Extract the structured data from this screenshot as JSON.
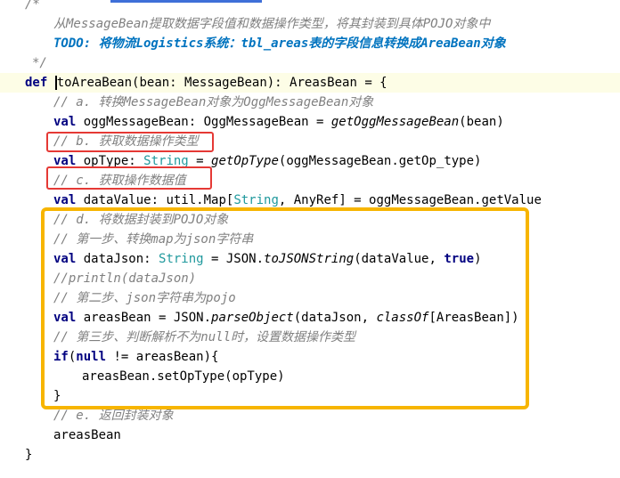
{
  "editor": {
    "lines": {
      "l0": "/*",
      "l1": "从MessageBean提取数据字段值和数据操作类型，将其封装到具体POJO对象中",
      "l2": "TODO: 将物流Logistics系统：tbl_areas表的字段信息转换成AreaBean对象",
      "l3": "*/",
      "l4_kw": "def",
      "l4_fn": "toAreaBean",
      "l4_rest": "(bean: MessageBean): AreasBean = {",
      "l5": "// a. 转换MessageBean对象为OggMessageBean对象",
      "l6_kw": "val",
      "l6_a": " oggMessageBean: OggMessageBean = ",
      "l6_fn": "getOggMessageBean",
      "l6_b": "(bean)",
      "l7": "// b. 获取数据操作类型",
      "l8_kw": "val",
      "l8_a": " opType: ",
      "l8_type": "String",
      "l8_b": " = ",
      "l8_fn": "getOpType",
      "l8_c": "(oggMessageBean.getOp_type)",
      "l9": "// c. 获取操作数据值",
      "l10_kw": "val",
      "l10_a": " dataValue: util.Map[",
      "l10_type": "String",
      "l10_b": ", AnyRef] = oggMessageBean.getValue",
      "l11": "// d. 将数据封装到POJO对象",
      "l12": "// 第一步、转换map为json字符串",
      "l13_kw": "val",
      "l13_a": " dataJson: ",
      "l13_type": "String",
      "l13_b": " = JSON.",
      "l13_fn": "toJSONString",
      "l13_c": "(dataValue, ",
      "l13_kw2": "true",
      "l13_d": ")",
      "l14": "//println(dataJson)",
      "l15": "// 第二步、json字符串为pojo",
      "l16_kw": "val",
      "l16_a": " areasBean = JSON.",
      "l16_fn": "parseObject",
      "l16_b": "(dataJson, ",
      "l16_fn2": "classOf",
      "l16_c": "[AreasBean])",
      "l17": "// 第三步、判断解析不为null时，设置数据操作类型",
      "l18_kw": "if",
      "l18_a": "(",
      "l18_kw2": "null",
      "l18_b": " != areasBean){",
      "l19": "areasBean.setOpType(opType)",
      "l20": "}",
      "l21": "// e. 返回封装对象",
      "l22": "areasBean",
      "l23": "}"
    },
    "colors": {
      "keyword": "#000080",
      "comment": "#808080",
      "todo": "#0073bf",
      "type": "#20999d",
      "annotation_red": "#e53935",
      "annotation_yellow": "#f7b500"
    }
  }
}
